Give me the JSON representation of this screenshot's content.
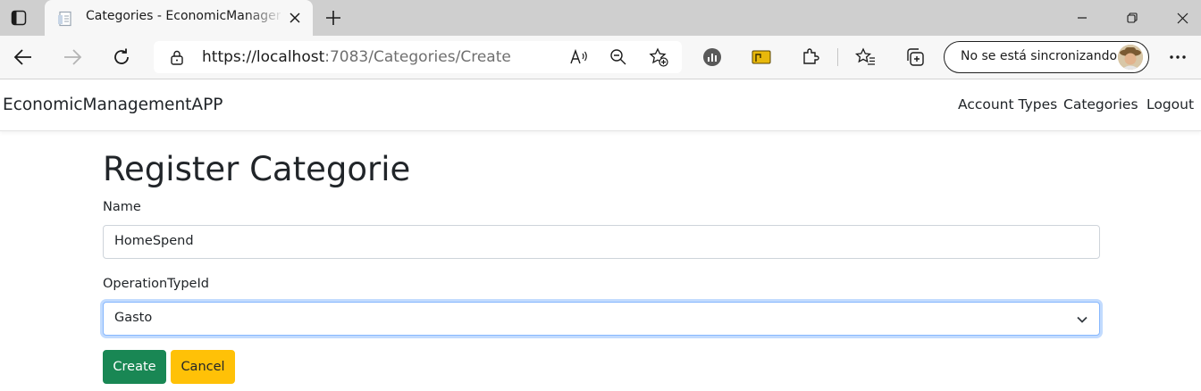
{
  "browser": {
    "tab_title": "Categories - EconomicManagementAPP",
    "url_host": "https://localhost",
    "url_path": ":7083/Categories/Create",
    "profile_label": "No se está sincronizando"
  },
  "app": {
    "brand": "EconomicManagementAPP",
    "nav": [
      {
        "label": "Account Types"
      },
      {
        "label": "Categories"
      },
      {
        "label": "Logout"
      }
    ]
  },
  "form": {
    "title": "Register Categorie",
    "name_label": "Name",
    "name_value": "HomeSpend",
    "operation_label": "OperationTypeId",
    "operation_value": "Gasto",
    "create_label": "Create",
    "cancel_label": "Cancel"
  },
  "colors": {
    "create_button": "#198754",
    "cancel_button": "#ffc107",
    "focus_ring": "#86b7fe"
  }
}
